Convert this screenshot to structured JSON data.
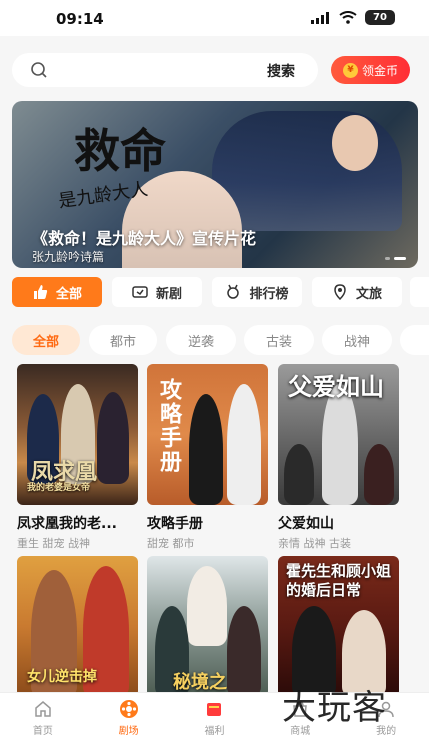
{
  "status": {
    "time": "09:14",
    "battery": "70"
  },
  "search": {
    "button_label": "搜索",
    "coin_label": "领金币"
  },
  "banner": {
    "logo_main": "救命",
    "logo_sub": "是九龄大人",
    "title": "《救命！是九龄大人》宣传片花",
    "subtitle": "张九龄吟诗篇"
  },
  "categories": [
    {
      "label": "全部",
      "icon": "thumbs-up-icon"
    },
    {
      "label": "新剧",
      "icon": "new-show-icon"
    },
    {
      "label": "排行榜",
      "icon": "ranking-icon"
    },
    {
      "label": "文旅",
      "icon": "travel-icon"
    }
  ],
  "filters": [
    "全部",
    "都市",
    "逆袭",
    "古装",
    "战神"
  ],
  "dramas": [
    {
      "title": "凤求凰我的老...",
      "tags": "重生 甜宠 战神",
      "poster_text": "凤求凰",
      "poster_sub": "我的老婆是女帝"
    },
    {
      "title": "攻略手册",
      "tags": "甜宠 都市",
      "poster_text": "攻略手册",
      "poster_sub": ""
    },
    {
      "title": "父爱如山",
      "tags": "亲情 战神 古装",
      "poster_text": "父爱如山",
      "poster_sub": ""
    },
    {
      "title": "",
      "tags": "",
      "poster_text": "女儿逆击掉",
      "poster_sub": ""
    },
    {
      "title": "",
      "tags": "",
      "poster_text": "秘境之",
      "poster_sub": ""
    },
    {
      "title": "",
      "tags": "",
      "poster_text": "霍先生和顾小姐的婚后日常",
      "poster_sub": ""
    }
  ],
  "nav": [
    {
      "label": "首页",
      "icon": "home-icon"
    },
    {
      "label": "剧场",
      "icon": "theater-icon"
    },
    {
      "label": "福利",
      "icon": "gift-icon"
    },
    {
      "label": "商城",
      "icon": "shop-icon"
    },
    {
      "label": "我的",
      "icon": "profile-icon"
    }
  ],
  "watermark": "大玩客",
  "colors": {
    "accent": "#ff7a1a",
    "coin_button": "#ff2e35"
  }
}
